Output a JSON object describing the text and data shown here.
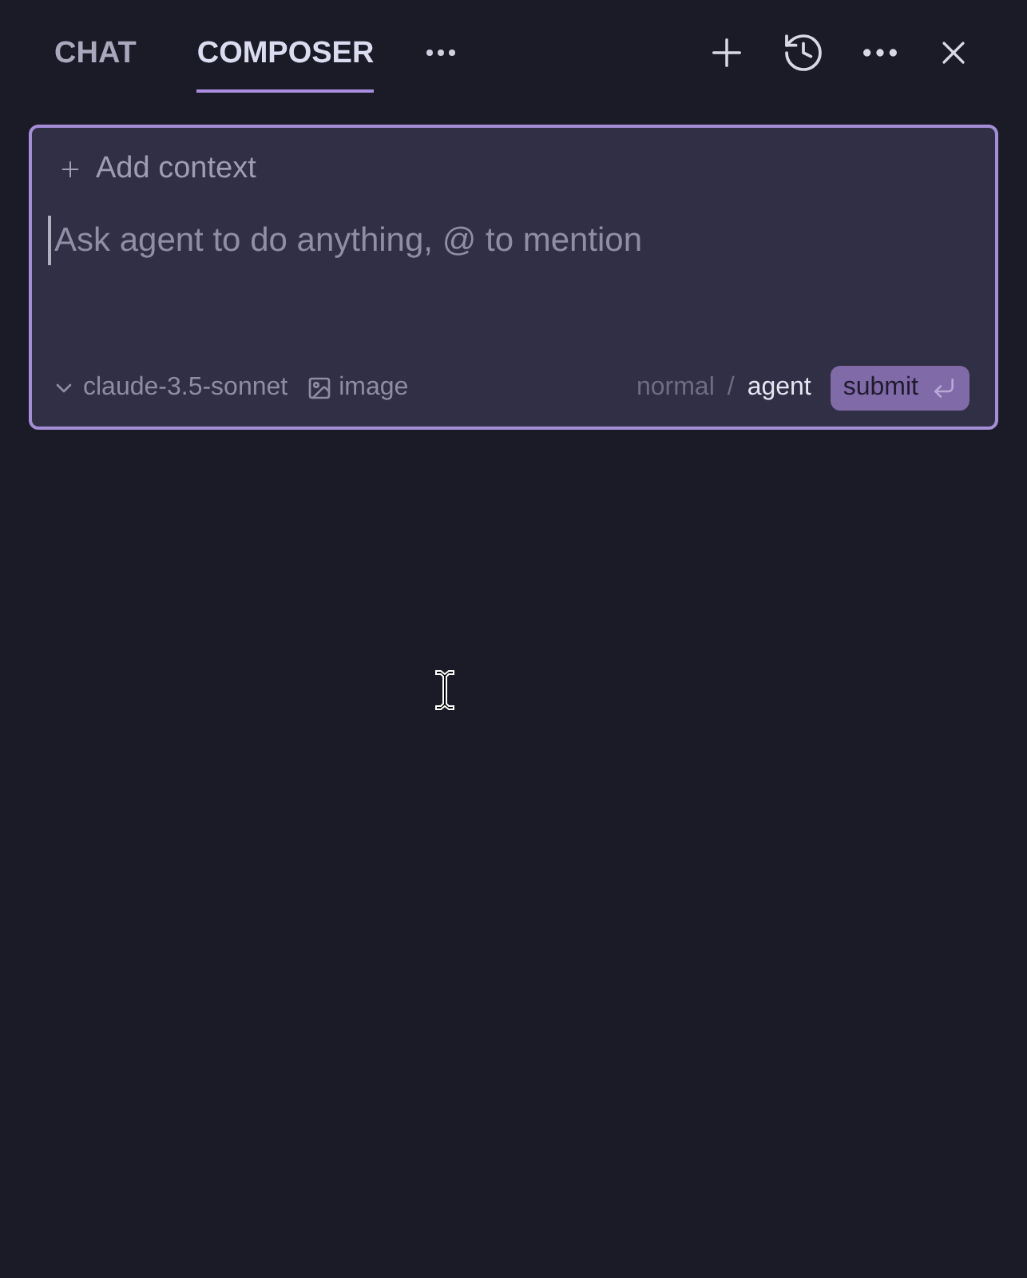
{
  "tabs": [
    {
      "label": "CHAT",
      "selected": false
    },
    {
      "label": "COMPOSER",
      "selected": true
    }
  ],
  "composer": {
    "add_context": "Add context",
    "placeholder": "Ask agent to do anything, @ to mention",
    "model": "claude-3.5-sonnet",
    "image": "image",
    "modes": [
      {
        "label": "normal",
        "selected": false
      },
      {
        "label": "agent",
        "selected": true
      }
    ],
    "separator": "/",
    "submit": "submit"
  }
}
